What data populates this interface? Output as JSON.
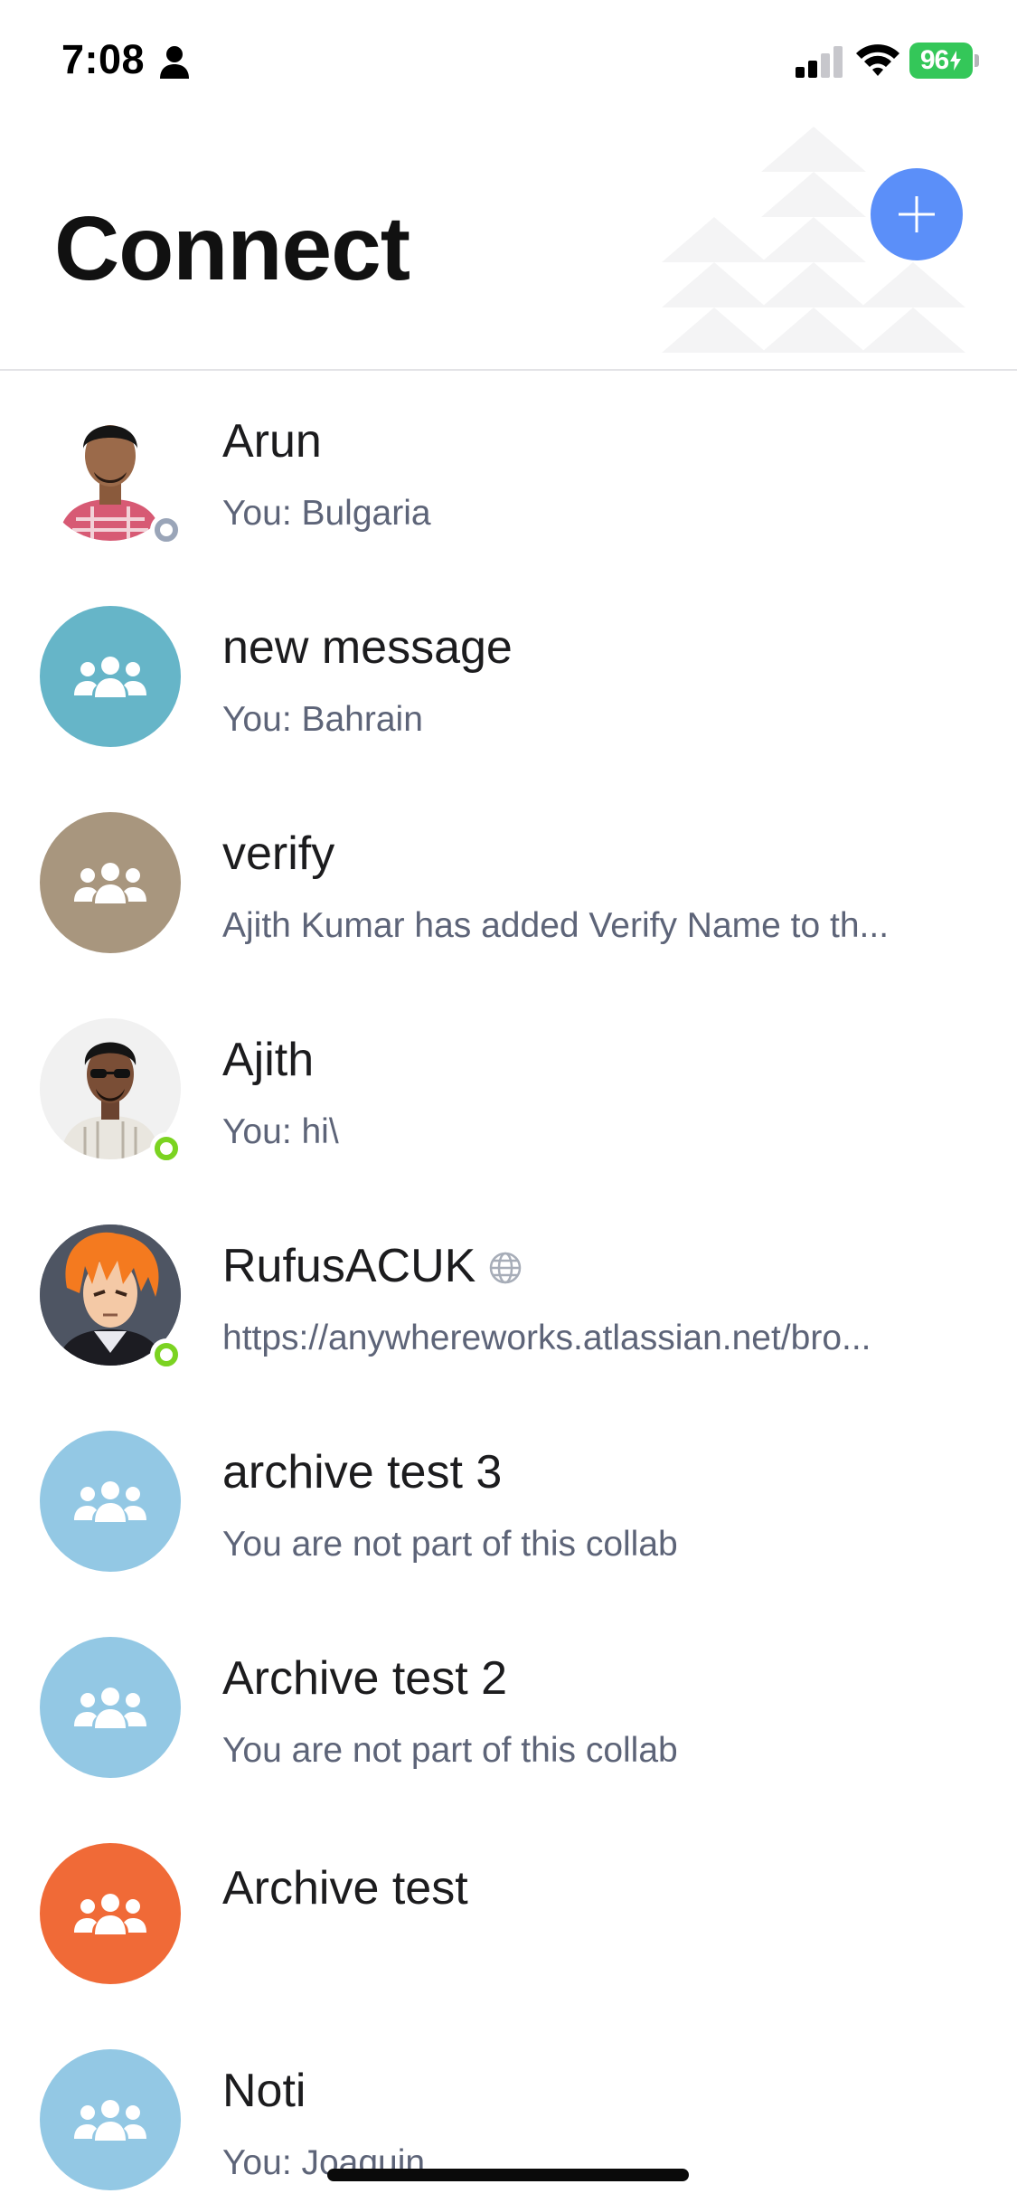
{
  "status_bar": {
    "time": "7:08",
    "battery": "96"
  },
  "header": {
    "title": "Connect",
    "add_icon": "plus-icon"
  },
  "colors": {
    "accent": "#5b8ff9",
    "online": "#7bd321",
    "offline": "#9aa5b8",
    "group_teal": "#66b5c8",
    "group_taupe": "#a8967e",
    "group_light_blue": "#93c8e4",
    "group_orange": "#f06a37"
  },
  "conversations": [
    {
      "name": "Arun",
      "preview": "You: Bulgaria",
      "avatar": "person-photo",
      "presence": "offline"
    },
    {
      "name": "new message",
      "preview": "You: Bahrain",
      "avatar": "group-icon",
      "color": "#66b5c8"
    },
    {
      "name": "verify",
      "preview": "Ajith Kumar has added Verify Name to th...",
      "avatar": "group-icon",
      "color": "#a8967e"
    },
    {
      "name": "Ajith",
      "preview": "You: hi\\",
      "avatar": "person-photo",
      "presence": "online"
    },
    {
      "name": "RufusACUK",
      "preview": "https://anywhereworks.atlassian.net/bro...",
      "avatar": "anime-avatar",
      "presence": "online",
      "badge": "globe-icon"
    },
    {
      "name": "archive test 3",
      "preview": "You are not part of this collab",
      "avatar": "group-icon",
      "color": "#93c8e4"
    },
    {
      "name": "Archive test 2",
      "preview": "You are not part of this collab",
      "avatar": "group-icon",
      "color": "#93c8e4"
    },
    {
      "name": "Archive test",
      "preview": "",
      "avatar": "group-icon",
      "color": "#f06a37"
    },
    {
      "name": "Noti",
      "preview": "You: Joaquin",
      "avatar": "group-icon",
      "color": "#93c8e4"
    }
  ]
}
